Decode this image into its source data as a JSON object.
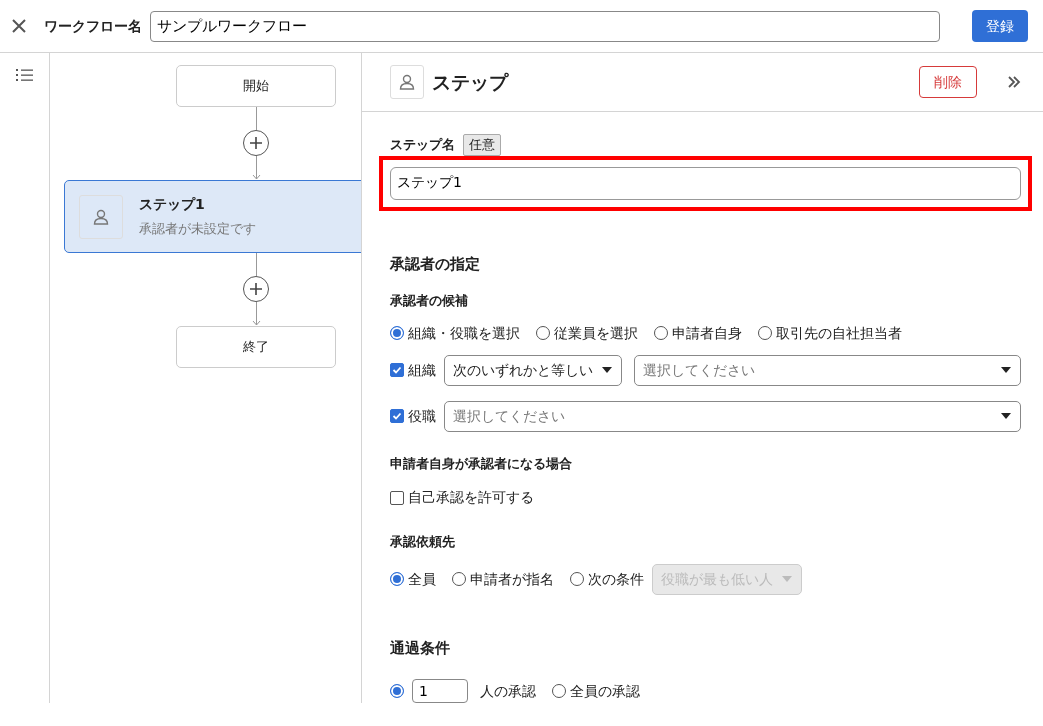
{
  "header": {
    "title_label": "ワークフロー名",
    "workflow_name": "サンプルワークフロー",
    "register_button": "登録"
  },
  "flow": {
    "nodes": [
      {
        "kind": "terminal",
        "label": "開始"
      },
      {
        "kind": "step",
        "title": "ステップ1",
        "subtitle": "承認者が未設定です",
        "selected": true
      },
      {
        "kind": "terminal",
        "label": "終了"
      }
    ]
  },
  "panel": {
    "title": "ステップ",
    "delete_button": "削除",
    "step_name": {
      "label": "ステップ名",
      "badge": "任意",
      "value": "ステップ1",
      "highlighted": true
    },
    "approver_section": {
      "title": "承認者の指定",
      "candidates_label": "承認者の候補",
      "candidate_options": [
        {
          "label": "組織・役職を選択",
          "selected": true
        },
        {
          "label": "従業員を選択",
          "selected": false
        },
        {
          "label": "申請者自身",
          "selected": false
        },
        {
          "label": "取引先の自社担当者",
          "selected": false
        }
      ],
      "filters": [
        {
          "label": "組織",
          "checked": true,
          "operator": "次のいずれかと等しい",
          "placeholder": "選択してください"
        },
        {
          "label": "役職",
          "checked": true,
          "placeholder": "選択してください"
        }
      ]
    },
    "self_approval": {
      "title": "申請者自身が承認者になる場合",
      "label": "自己承認を許可する",
      "checked": false
    },
    "request_to": {
      "title": "承認依頼先",
      "options": [
        {
          "label": "全員",
          "selected": true
        },
        {
          "label": "申請者が指名",
          "selected": false
        },
        {
          "label": "次の条件",
          "selected": false
        }
      ],
      "condition_select": {
        "value": "役職が最も低い人",
        "disabled": true
      }
    },
    "pass_condition": {
      "title": "通過条件",
      "options": [
        {
          "kind": "count",
          "value": "1",
          "label": "人の承認",
          "selected": true
        },
        {
          "kind": "plain",
          "label": "全員の承認",
          "selected": false
        }
      ]
    }
  }
}
